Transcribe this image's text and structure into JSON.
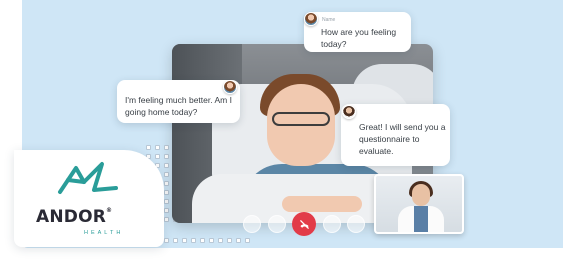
{
  "colors": {
    "background_panel": "#cfe6f6",
    "end_call": "#e23b48",
    "logo_teal": "#2a9d99",
    "logo_dark": "#2a2a35"
  },
  "chat": [
    {
      "sender": "Name",
      "side": "right",
      "avatar": "patient-avatar",
      "message": "How are you feeling today?"
    },
    {
      "sender": "",
      "side": "left",
      "avatar": "patient-avatar",
      "message": "I'm feeling much better. Am I going home today?"
    },
    {
      "sender": "",
      "side": "right",
      "avatar": "doctor-avatar",
      "message": "Great! I will send you a questionnaire to evaluate."
    }
  ],
  "call_controls": [
    "mic-icon",
    "camera-icon",
    "end-call-icon",
    "screen-share-icon",
    "more-icon"
  ],
  "logo": {
    "name": "ANDOR",
    "registered": "®",
    "subtitle": "HEALTH"
  }
}
